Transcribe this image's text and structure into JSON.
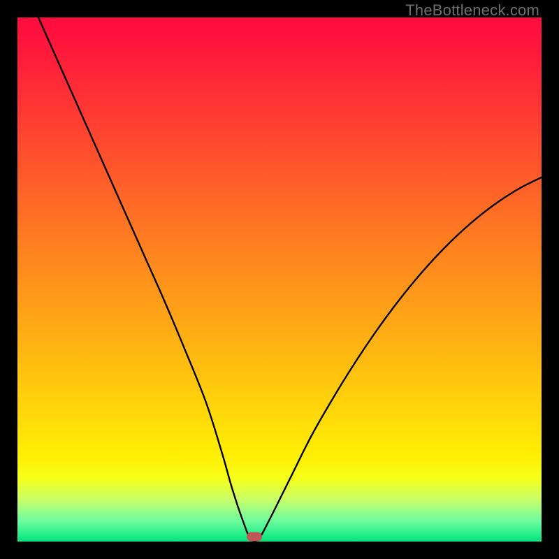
{
  "watermark": "TheBottleneck.com",
  "chart_data": {
    "type": "line",
    "title": "",
    "xlabel": "",
    "ylabel": "",
    "xlim": [
      0,
      100
    ],
    "ylim": [
      0,
      100
    ],
    "grid": false,
    "legend": false,
    "series": [
      {
        "name": "curve",
        "x": [
          4,
          8,
          12,
          16,
          20,
          24,
          28,
          32,
          36,
          39,
          41,
          43,
          44.5,
          46,
          48,
          52,
          56,
          60,
          64,
          68,
          72,
          76,
          80,
          84,
          88,
          92,
          96,
          100
        ],
        "y": [
          100,
          91,
          82,
          73,
          64,
          55,
          46,
          36.5,
          26.5,
          17,
          10,
          4,
          0.5,
          0.5,
          4,
          12,
          20,
          27,
          33.5,
          39.5,
          45,
          50,
          54.5,
          58.5,
          62,
          65,
          67.5,
          69.5
        ]
      }
    ],
    "marker": {
      "x": 45.2,
      "y": 0.9
    },
    "background_gradient": {
      "direction": "vertical",
      "stops": [
        {
          "pos": 0.0,
          "color": "#ff0b3f"
        },
        {
          "pos": 0.3,
          "color": "#ff5a2a"
        },
        {
          "pos": 0.58,
          "color": "#ffa716"
        },
        {
          "pos": 0.84,
          "color": "#fff004"
        },
        {
          "pos": 1.0,
          "color": "#02e57e"
        }
      ]
    }
  }
}
